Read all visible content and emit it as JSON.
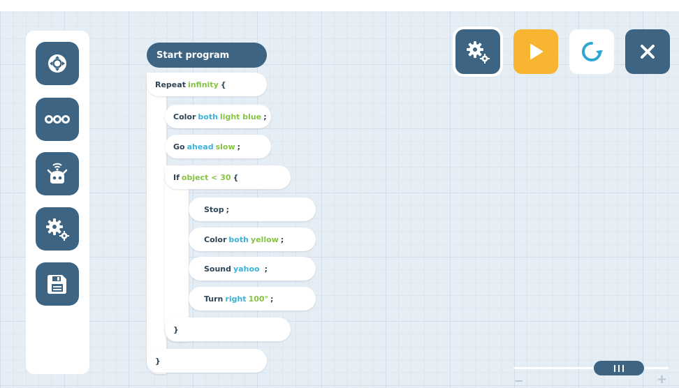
{
  "colors": {
    "primary": "#3d6482",
    "accent": "#f7b531",
    "param_blue": "#3bb3d8",
    "param_green": "#86c245"
  },
  "sidebar": {
    "items": [
      {
        "icon": "directional-pad-icon"
      },
      {
        "icon": "more-dots-icon"
      },
      {
        "icon": "robot-wireless-icon"
      },
      {
        "icon": "gears-icon"
      },
      {
        "icon": "save-icon"
      }
    ]
  },
  "toolbar": {
    "settings_icon": "gears-icon",
    "play_icon": "play-icon",
    "refresh_icon": "refresh-icon",
    "close_icon": "close-icon"
  },
  "program": {
    "start_label": "Start program",
    "repeat": {
      "keyword": "Repeat",
      "arg": "infinity",
      "open": "{",
      "close": "}"
    },
    "color1": {
      "keyword": "Color",
      "target": "both",
      "value": "light blue",
      "end": ";"
    },
    "go": {
      "keyword": "Go",
      "direction": "ahead",
      "speed": "slow",
      "end": ";"
    },
    "if": {
      "keyword": "If",
      "condition": "object < 30",
      "open": "{",
      "close": "}"
    },
    "stop": {
      "keyword": "Stop",
      "end": ";"
    },
    "color2": {
      "keyword": "Color",
      "target": "both",
      "value": "yellow",
      "end": ";"
    },
    "sound": {
      "keyword": "Sound",
      "value": "yahoo",
      "end": ";"
    },
    "turn": {
      "keyword": "Turn",
      "direction": "right",
      "angle": "100°",
      "end": ";"
    }
  },
  "zoom": {
    "minus": "−",
    "plus": "+"
  }
}
